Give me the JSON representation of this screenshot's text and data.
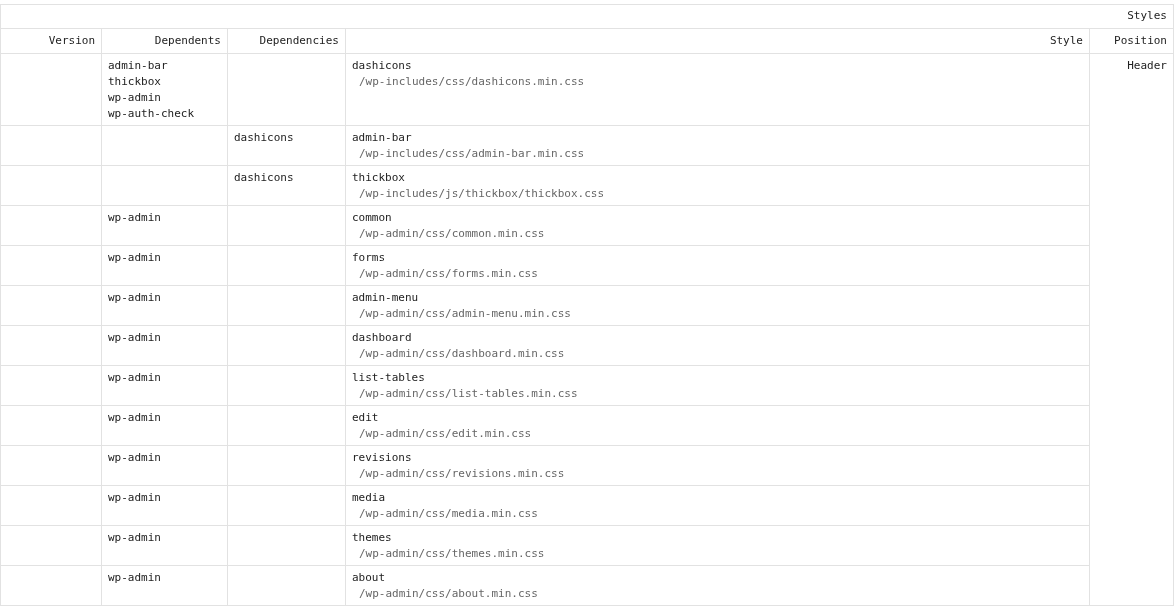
{
  "table": {
    "caption": "Styles",
    "columns": [
      "Version",
      "Dependents",
      "Dependencies",
      "Style",
      "Position"
    ],
    "position": "Header",
    "rows": [
      {
        "dependents": [
          "admin-bar",
          "thickbox",
          "wp-admin",
          "wp-auth-check"
        ],
        "dependencies": [],
        "handle": "dashicons",
        "path": "/wp-includes/css/dashicons.min.css"
      },
      {
        "dependents": [],
        "dependencies": [
          "dashicons"
        ],
        "handle": "admin-bar",
        "path": "/wp-includes/css/admin-bar.min.css"
      },
      {
        "dependents": [],
        "dependencies": [
          "dashicons"
        ],
        "handle": "thickbox",
        "path": "/wp-includes/js/thickbox/thickbox.css"
      },
      {
        "dependents": [
          "wp-admin"
        ],
        "dependencies": [],
        "handle": "common",
        "path": "/wp-admin/css/common.min.css"
      },
      {
        "dependents": [
          "wp-admin"
        ],
        "dependencies": [],
        "handle": "forms",
        "path": "/wp-admin/css/forms.min.css"
      },
      {
        "dependents": [
          "wp-admin"
        ],
        "dependencies": [],
        "handle": "admin-menu",
        "path": "/wp-admin/css/admin-menu.min.css"
      },
      {
        "dependents": [
          "wp-admin"
        ],
        "dependencies": [],
        "handle": "dashboard",
        "path": "/wp-admin/css/dashboard.min.css"
      },
      {
        "dependents": [
          "wp-admin"
        ],
        "dependencies": [],
        "handle": "list-tables",
        "path": "/wp-admin/css/list-tables.min.css"
      },
      {
        "dependents": [
          "wp-admin"
        ],
        "dependencies": [],
        "handle": "edit",
        "path": "/wp-admin/css/edit.min.css"
      },
      {
        "dependents": [
          "wp-admin"
        ],
        "dependencies": [],
        "handle": "revisions",
        "path": "/wp-admin/css/revisions.min.css"
      },
      {
        "dependents": [
          "wp-admin"
        ],
        "dependencies": [],
        "handle": "media",
        "path": "/wp-admin/css/media.min.css"
      },
      {
        "dependents": [
          "wp-admin"
        ],
        "dependencies": [],
        "handle": "themes",
        "path": "/wp-admin/css/themes.min.css"
      },
      {
        "dependents": [
          "wp-admin"
        ],
        "dependencies": [],
        "handle": "about",
        "path": "/wp-admin/css/about.min.css"
      }
    ]
  }
}
